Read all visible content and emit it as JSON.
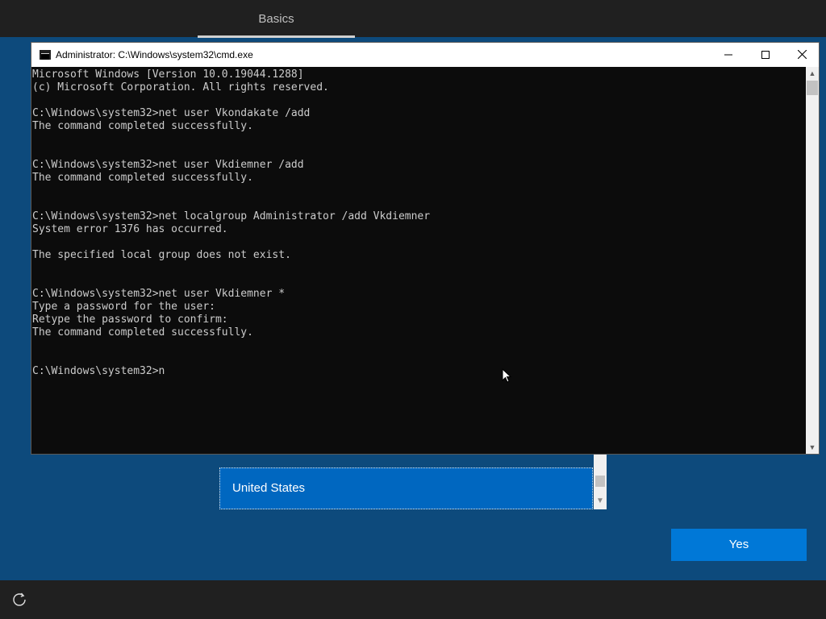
{
  "oobe": {
    "tab_label": "Basics",
    "region_selected": "United States",
    "yes_label": "Yes",
    "ease_icon": "accessibility-icon"
  },
  "cmd": {
    "title": "Administrator: C:\\Windows\\system32\\cmd.exe",
    "lines": [
      "Microsoft Windows [Version 10.0.19044.1288]",
      "(c) Microsoft Corporation. All rights reserved.",
      "",
      "C:\\Windows\\system32>net user Vkondakate /add",
      "The command completed successfully.",
      "",
      "",
      "C:\\Windows\\system32>net user Vkdiemner /add",
      "The command completed successfully.",
      "",
      "",
      "C:\\Windows\\system32>net localgroup Administrator /add Vkdiemner",
      "System error 1376 has occurred.",
      "",
      "The specified local group does not exist.",
      "",
      "",
      "C:\\Windows\\system32>net user Vkdiemner *",
      "Type a password for the user:",
      "Retype the password to confirm:",
      "The command completed successfully.",
      "",
      "",
      "C:\\Windows\\system32>n"
    ]
  },
  "colors": {
    "background": "#0d4a7c",
    "accent": "#0078d7",
    "selected_item": "#0067c0"
  }
}
